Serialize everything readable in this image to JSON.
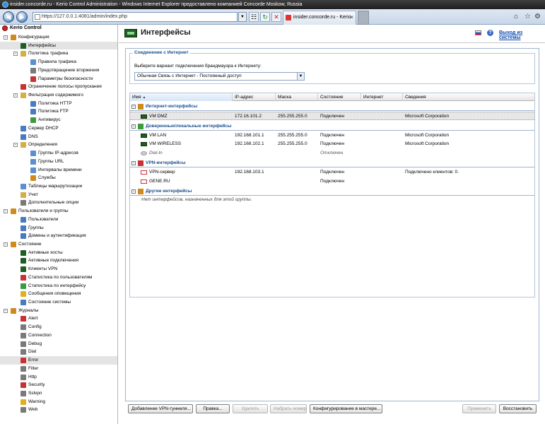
{
  "window": {
    "title": "insider.concorde.ru - Kerio Control Administration - Windows Internet Explorer предоставлено компанией Concorde Moskow, Russia"
  },
  "browser": {
    "url": "https://127.0.0.1:4081/admin/index.php",
    "tab_title": "insider.concorde.ru - Kerio C...",
    "back_icon": "back-arrow-icon",
    "forward_icon": "forward-arrow-icon"
  },
  "sidebar": {
    "app_title": "Kerio Control",
    "items": [
      {
        "label": "Конфигурация",
        "level": 0,
        "expander": "-",
        "icon_color": "#d08a1c"
      },
      {
        "label": "Интерфейсы",
        "level": 1,
        "selected": true,
        "icon_color": "#1f5d22"
      },
      {
        "label": "Политика трафика",
        "level": 1,
        "expander": "-",
        "icon_color": "#d2b048"
      },
      {
        "label": "Правила трафика",
        "level": 2,
        "icon_color": "#5b8fd1"
      },
      {
        "label": "Предотвращение вторжения",
        "level": 2,
        "icon_color": "#7a7a7a"
      },
      {
        "label": "Параметры безопасности",
        "level": 2,
        "icon_color": "#c83232"
      },
      {
        "label": "Ограничение полосы пропускания",
        "level": 1,
        "icon_color": "#c83232"
      },
      {
        "label": "Фильтрация содержимого",
        "level": 1,
        "expander": "-",
        "icon_color": "#d2b048"
      },
      {
        "label": "Политика HTTP",
        "level": 2,
        "icon_color": "#4a7bc0"
      },
      {
        "label": "Политика FTP",
        "level": 2,
        "icon_color": "#4a7bc0"
      },
      {
        "label": "Антивирус",
        "level": 2,
        "icon_color": "#3d9a3d"
      },
      {
        "label": "Сервер DHCP",
        "level": 1,
        "icon_color": "#4a7bc0"
      },
      {
        "label": "DNS",
        "level": 1,
        "icon_color": "#4a7bc0"
      },
      {
        "label": "Определения",
        "level": 1,
        "expander": "-",
        "icon_color": "#d2b048"
      },
      {
        "label": "Группы IP-адресов",
        "level": 2,
        "icon_color": "#5b8fd1"
      },
      {
        "label": "Группы URL",
        "level": 2,
        "icon_color": "#5b8fd1"
      },
      {
        "label": "Интервалы времени",
        "level": 2,
        "icon_color": "#5b8fd1"
      },
      {
        "label": "Службы",
        "level": 2,
        "icon_color": "#d08a1c"
      },
      {
        "label": "Таблицы маршрутизации",
        "level": 1,
        "icon_color": "#5b8fd1"
      },
      {
        "label": "Учет",
        "level": 1,
        "icon_color": "#d2b048"
      },
      {
        "label": "Дополнительные опции",
        "level": 1,
        "icon_color": "#7a7a7a"
      },
      {
        "label": "Пользователи и группы",
        "level": 0,
        "expander": "-",
        "icon_color": "#d08a1c"
      },
      {
        "label": "Пользователи",
        "level": 1,
        "icon_color": "#4a7bc0"
      },
      {
        "label": "Группы",
        "level": 1,
        "icon_color": "#4a7bc0"
      },
      {
        "label": "Домены и аутентификация",
        "level": 1,
        "icon_color": "#4a7bc0"
      },
      {
        "label": "Состояние",
        "level": 0,
        "expander": "-",
        "icon_color": "#d08a1c"
      },
      {
        "label": "Активные хосты",
        "level": 1,
        "icon_color": "#1f5d22"
      },
      {
        "label": "Активные подключения",
        "level": 1,
        "icon_color": "#1f5d22"
      },
      {
        "label": "Клиенты VPN",
        "level": 1,
        "icon_color": "#1f5d22"
      },
      {
        "label": "Статистика по пользователям",
        "level": 1,
        "icon_color": "#c83232"
      },
      {
        "label": "Статистика по интерфейсу",
        "level": 1,
        "icon_color": "#3d9a3d"
      },
      {
        "label": "Сообщения оповещения",
        "level": 1,
        "icon_color": "#e0b020"
      },
      {
        "label": "Состояние системы",
        "level": 1,
        "icon_color": "#4a7bc0"
      },
      {
        "label": "Журналы",
        "level": 0,
        "expander": "-",
        "icon_color": "#d08a1c"
      },
      {
        "label": "Alert",
        "level": 1,
        "icon_color": "#c83232"
      },
      {
        "label": "Config",
        "level": 1,
        "icon_color": "#7a7a7a"
      },
      {
        "label": "Connection",
        "level": 1,
        "icon_color": "#7a7a7a"
      },
      {
        "label": "Debug",
        "level": 1,
        "icon_color": "#7a7a7a"
      },
      {
        "label": "Dial",
        "level": 1,
        "icon_color": "#7a7a7a"
      },
      {
        "label": "Error",
        "level": 1,
        "selected_hover": true,
        "icon_color": "#c83232"
      },
      {
        "label": "Filter",
        "level": 1,
        "icon_color": "#7a7a7a"
      },
      {
        "label": "Http",
        "level": 1,
        "icon_color": "#7a7a7a"
      },
      {
        "label": "Security",
        "level": 1,
        "icon_color": "#c83232"
      },
      {
        "label": "Sslvpn",
        "level": 1,
        "icon_color": "#7a7a7a"
      },
      {
        "label": "Warning",
        "level": 1,
        "icon_color": "#e0b020"
      },
      {
        "label": "Web",
        "level": 1,
        "icon_color": "#7a7a7a"
      }
    ]
  },
  "header": {
    "title": "Интерфейсы",
    "logout": "Выход из системы"
  },
  "connection": {
    "legend": "Соединение с Интернет",
    "prompt": "Выберите вариант подключения брандмауэра к Интернету:",
    "selected": "Обычная Связь с Интернет - Постоянный доступ"
  },
  "grid": {
    "columns": [
      "Имя",
      "IP-адрес",
      "Маска",
      "Состояние",
      "Интернет",
      "Сведения"
    ],
    "groups": [
      {
        "label": "Интернет-интерфейсы",
        "icon_color": "#d08a1c",
        "rows": [
          {
            "name": "VM DMZ",
            "ip": "172.16.101.2",
            "mask": "255.255.255.0",
            "state": "Подключен",
            "internet": "",
            "info": "Microsoft Corporation",
            "icon": "nic",
            "selected": true
          }
        ]
      },
      {
        "label": "Доверенные/локальные интерфейсы",
        "icon_color": "#3d9a3d",
        "rows": [
          {
            "name": "VM LAN",
            "ip": "192.168.101.1",
            "mask": "255.255.255.0",
            "state": "Подключен",
            "internet": "",
            "info": "Microsoft Corporation",
            "icon": "nic"
          },
          {
            "name": "VM WIRELESS",
            "ip": "192.168.102.1",
            "mask": "255.255.255.0",
            "state": "Подключен",
            "internet": "",
            "info": "Microsoft Corporation",
            "icon": "nic"
          },
          {
            "name": "Dial-In",
            "ip": "",
            "mask": "",
            "state": "Отключен",
            "internet": "",
            "info": "",
            "icon": "dial",
            "italic": true
          }
        ]
      },
      {
        "label": "VPN-интерфейсы",
        "icon_color": "#c83232",
        "rows": [
          {
            "name": "VPN-сервер",
            "ip": "192.168.103.1",
            "mask": "",
            "state": "Подключен",
            "internet": "",
            "info": "Подключено клиентов: 0.",
            "icon": "vpn"
          },
          {
            "name": "GENE.RU",
            "ip": "",
            "mask": "",
            "state": "Подключен",
            "internet": "",
            "info": "",
            "icon": "vpn"
          }
        ]
      },
      {
        "label": "Другие интерфейсы",
        "icon_color": "#d08a1c",
        "rows": [],
        "empty": "Нет интерфейсов, назначенных для этой группы."
      }
    ]
  },
  "buttons": {
    "add_vpn": "Добавление VPN-туннеля...",
    "edit": "Правка...",
    "delete": "Удалить",
    "dial": "Набрать номер",
    "wizard": "Конфигурирование в мастере...",
    "apply": "Применить",
    "restore": "Восстановить"
  }
}
